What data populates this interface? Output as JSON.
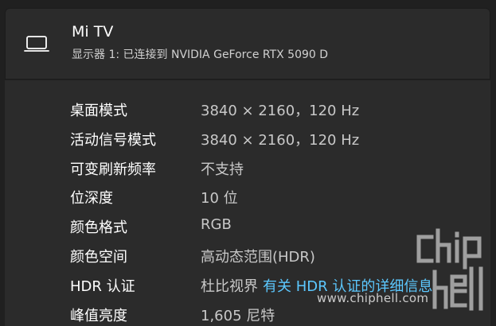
{
  "device": {
    "name": "Mi TV",
    "subtitle": "显示器 1: 已连接到 NVIDIA GeForce RTX 5090 D",
    "icon": "laptop-icon"
  },
  "properties": [
    {
      "label": "桌面模式",
      "value": "3840 × 2160，120 Hz"
    },
    {
      "label": "活动信号模式",
      "value": "3840 × 2160，120 Hz"
    },
    {
      "label": "可变刷新频率",
      "value": "不支持"
    },
    {
      "label": "位深度",
      "value": "10 位"
    },
    {
      "label": "颜色格式",
      "value": "RGB"
    },
    {
      "label": "颜色空间",
      "value": "高动态范围(HDR)"
    },
    {
      "label": "HDR 认证",
      "value": "杜比视界",
      "link": "有关 HDR 认证的详细信息"
    },
    {
      "label": "峰值亮度",
      "value": "1,605 尼特"
    }
  ],
  "watermark": {
    "site": "www.chiphell.com",
    "logo_text": "chip hell"
  },
  "colors": {
    "background": "#202020",
    "card": "#2b2b2b",
    "link": "#5cc8ff"
  }
}
